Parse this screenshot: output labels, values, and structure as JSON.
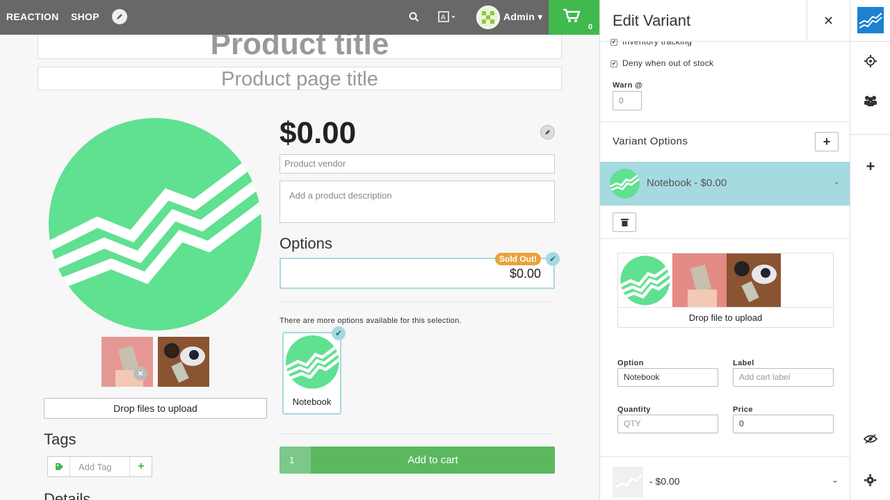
{
  "topnav": {
    "reaction": "REACTION",
    "shop": "SHOP",
    "user": "Admin",
    "cart_count": "0"
  },
  "product": {
    "title_placeholder": "Product title",
    "page_title_placeholder": "Product page title",
    "price": "$0.00",
    "vendor_placeholder": "Product vendor",
    "description_placeholder": "Add a product description",
    "options_heading": "Options",
    "option_price": "$0.00",
    "sold_out_badge": "Sold Out!",
    "more_options_text": "There are more options available for this selection.",
    "option_card_label": "Notebook",
    "quantity": "1",
    "add_to_cart": "Add to cart",
    "drop_files": "Drop files to upload",
    "tags_heading": "Tags",
    "add_tag_placeholder": "Add Tag",
    "details_heading": "Details"
  },
  "panel": {
    "title": "Edit Variant",
    "inventory_tracking": "Inventory tracking",
    "deny_out_of_stock": "Deny when out of stock",
    "warn_label": "Warn @",
    "warn_value": "0",
    "variant_options_heading": "Variant Options",
    "variant_row_label": "Notebook - $0.00",
    "media_drop": "Drop file to upload",
    "option_label": "Option",
    "option_value": "Notebook",
    "label_label": "Label",
    "label_placeholder": "Add cart label",
    "quantity_label": "Quantity",
    "quantity_placeholder": "QTY",
    "price_label": "Price",
    "price_value": "0",
    "second_variant_label": "- $0.00"
  },
  "colors": {
    "nav_bg": "#686868",
    "cart_green": "#40b94d",
    "logo_green": "#60e091",
    "selected_teal": "#a5dae0",
    "sold_out_orange": "#e9a33a",
    "add_cart_green": "#5bb85f"
  }
}
